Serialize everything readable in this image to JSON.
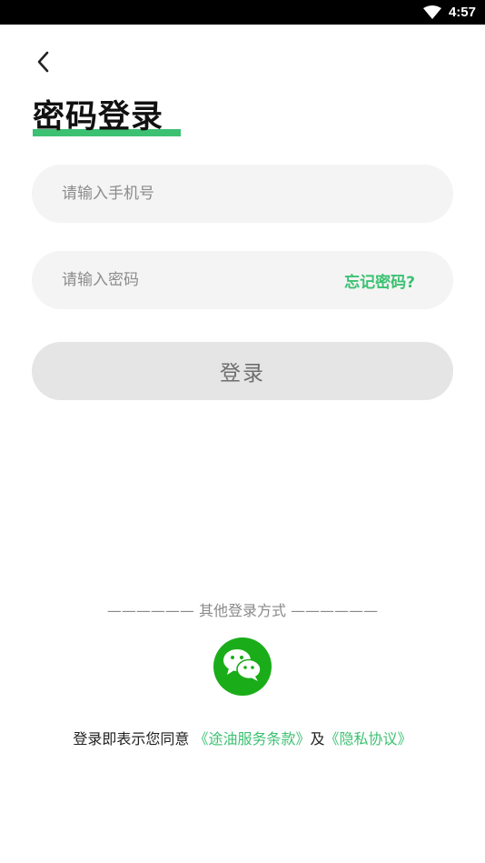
{
  "status_bar": {
    "time": "4:57",
    "icons": [
      "wifi-icon"
    ]
  },
  "header": {
    "back_icon": "chevron-left-icon",
    "title": "密码登录"
  },
  "form": {
    "phone_placeholder": "请输入手机号",
    "password_placeholder": "请输入密码",
    "forgot_password": "忘记密码?",
    "login_button": "登录"
  },
  "other_login": {
    "label": "—————— 其他登录方式 ——————",
    "wechat_icon": "wechat-icon"
  },
  "agreement": {
    "prefix": "登录即表示您同意 ",
    "terms_link": "《途油服务条款》",
    "conjunction": "及",
    "privacy_link": "《隐私协议》"
  },
  "colors": {
    "accent": "#3cc172",
    "wechat": "#1aad19",
    "input_bg": "#f4f4f4",
    "button_disabled": "#e5e5e5"
  }
}
